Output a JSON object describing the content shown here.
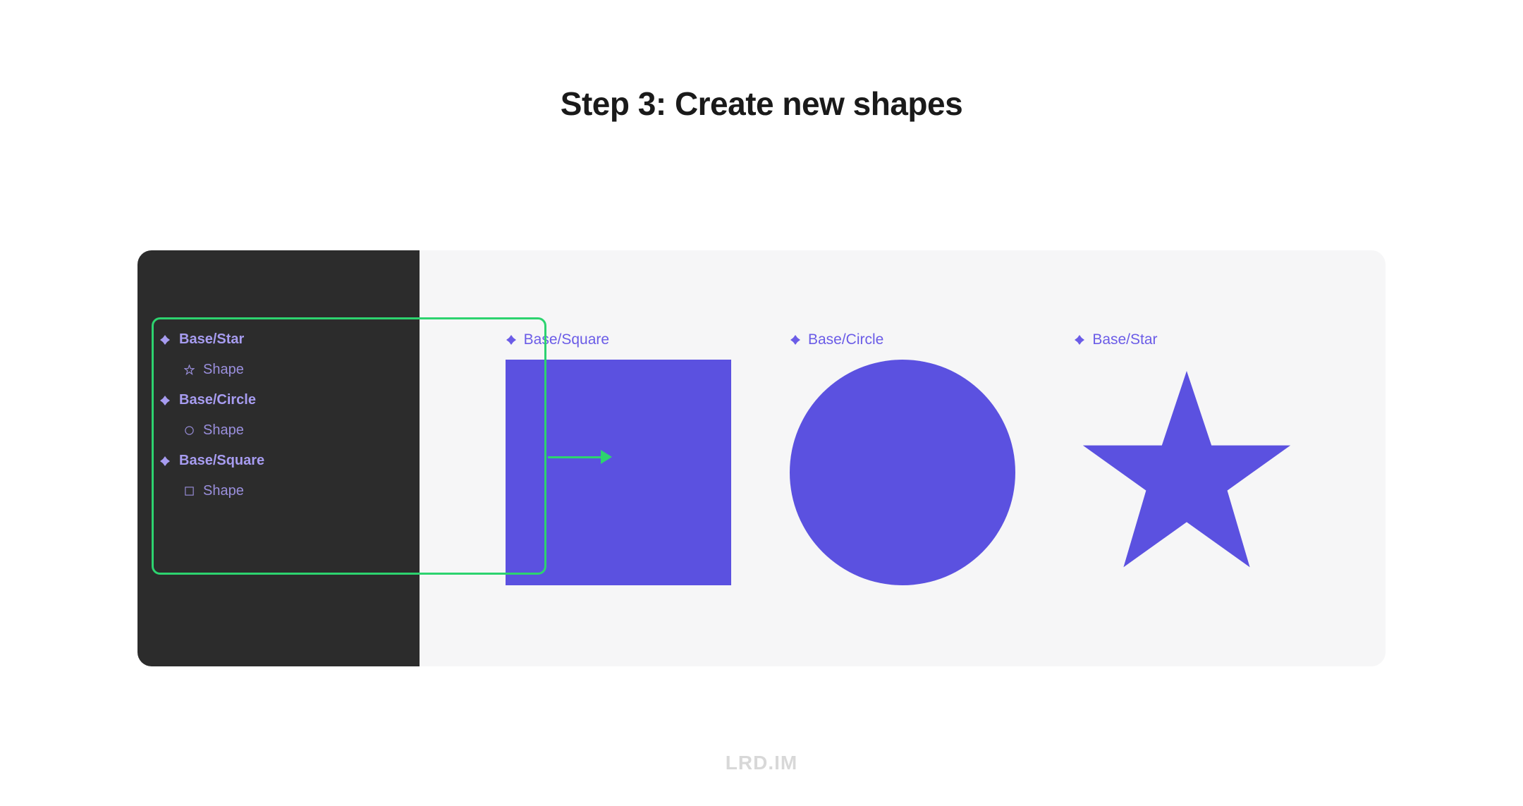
{
  "title": "Step 3: Create new shapes",
  "layers": {
    "items": [
      {
        "name": "Base/Star",
        "child": "Shape",
        "childIcon": "star"
      },
      {
        "name": "Base/Circle",
        "child": "Shape",
        "childIcon": "circle"
      },
      {
        "name": "Base/Square",
        "child": "Shape",
        "childIcon": "square"
      }
    ]
  },
  "shapes": {
    "items": [
      {
        "label": "Base/Square",
        "type": "square"
      },
      {
        "label": "Base/Circle",
        "type": "circle"
      },
      {
        "label": "Base/Star",
        "type": "star"
      }
    ]
  },
  "colors": {
    "shapeFill": "#5b51e0",
    "highlight": "#2dd36f",
    "componentText": "#a79cf0",
    "labelText": "#6b5ce7"
  },
  "watermark": "LRD.IM"
}
